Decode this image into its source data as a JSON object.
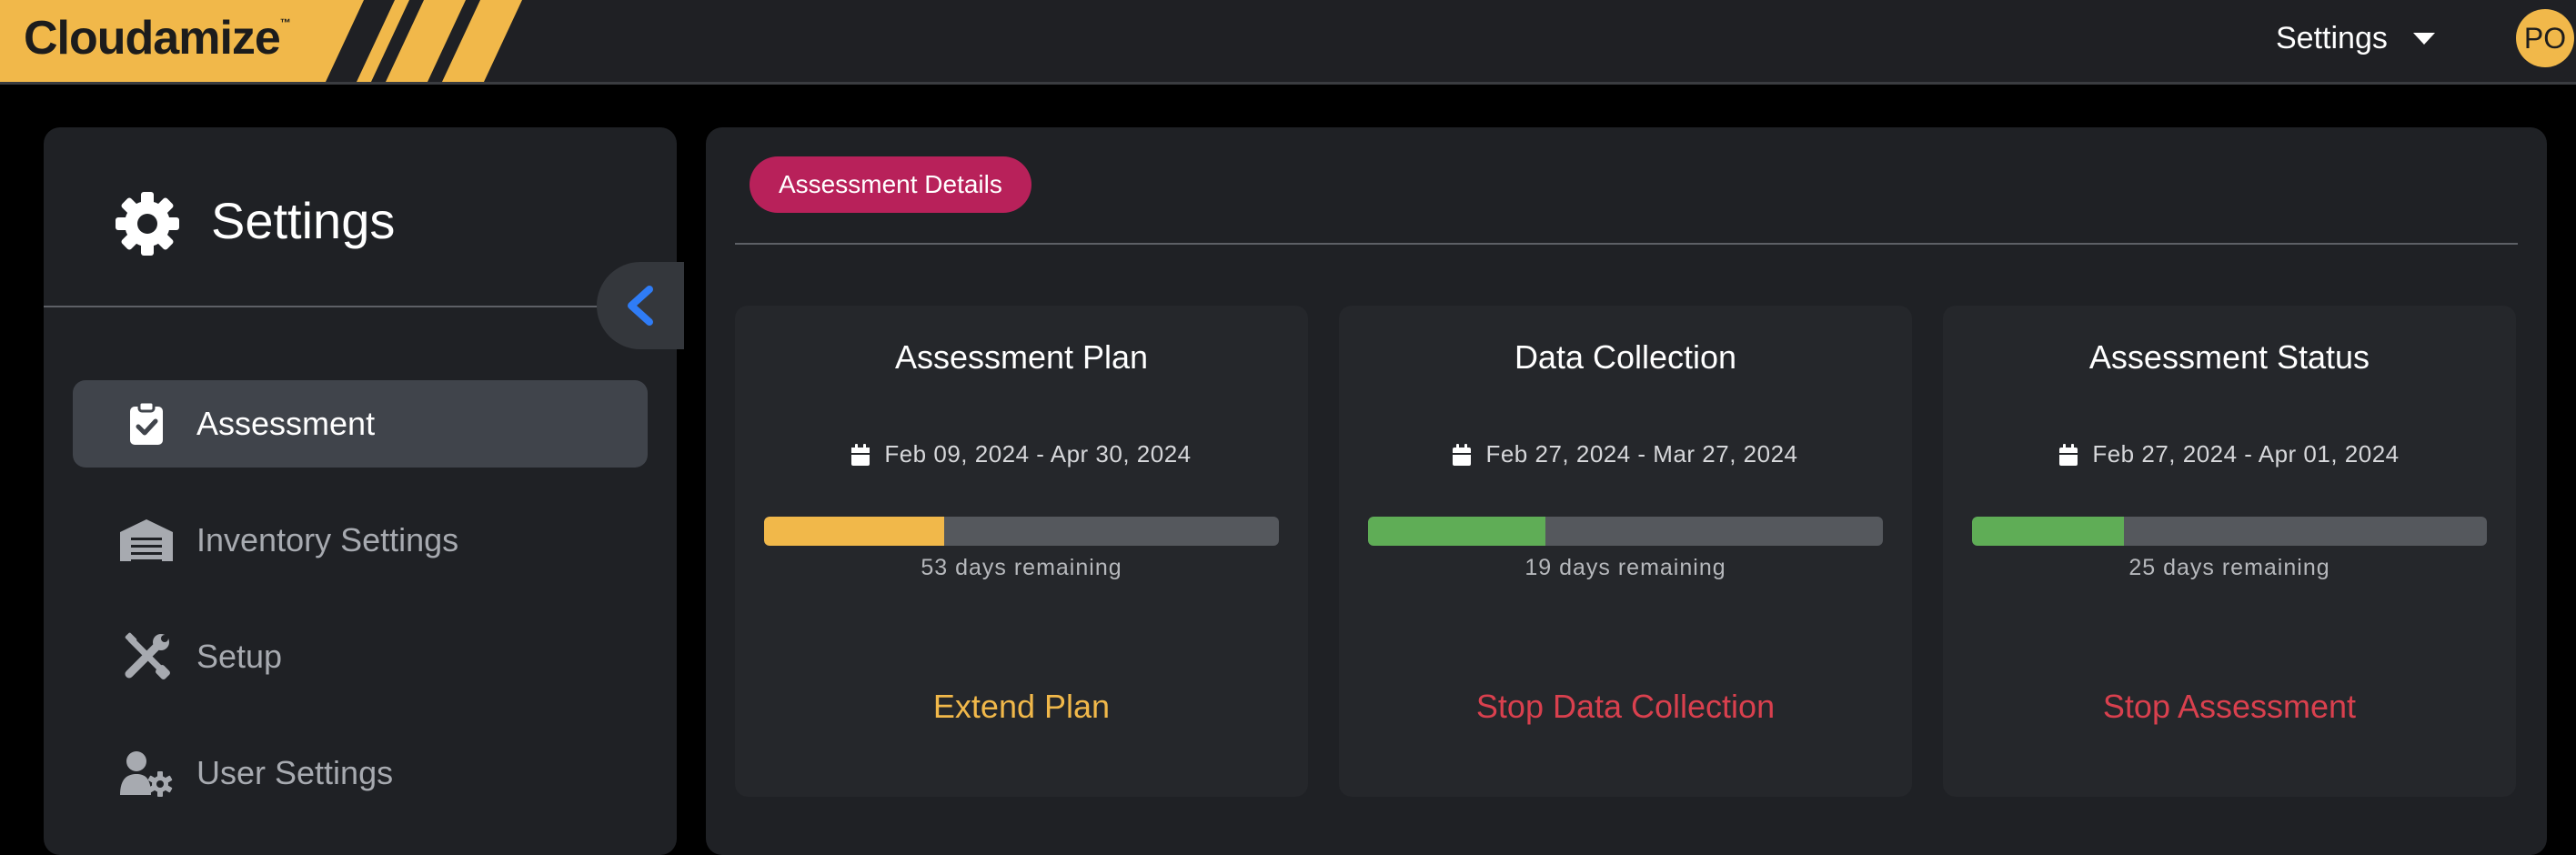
{
  "header": {
    "logo_text": "Cloudamize",
    "logo_tm": "™",
    "settings_label": "Settings",
    "avatar_initials": "PO",
    "brand_color": "#f1b84a"
  },
  "sidebar": {
    "title": "Settings",
    "items": [
      {
        "label": "Assessment",
        "icon": "clipboard-check-icon",
        "active": true
      },
      {
        "label": "Inventory Settings",
        "icon": "warehouse-icon",
        "active": false
      },
      {
        "label": "Setup",
        "icon": "tools-icon",
        "active": false
      },
      {
        "label": "User Settings",
        "icon": "user-gear-icon",
        "active": false
      }
    ]
  },
  "main": {
    "tab_label": "Assessment Details",
    "cards": [
      {
        "title": "Assessment Plan",
        "date_range": "Feb 09, 2024 - Apr 30, 2024",
        "progress": 0.35,
        "bar_color": "#f1b84a",
        "remaining": "53 days remaining",
        "action": "Extend Plan",
        "action_color": "#f1b84a"
      },
      {
        "title": "Data Collection",
        "date_range": "Feb 27, 2024 - Mar 27, 2024",
        "progress": 0.345,
        "bar_color": "#5fad56",
        "remaining": "19 days remaining",
        "action": "Stop Data Collection",
        "action_color": "#d9404e"
      },
      {
        "title": "Assessment Status",
        "date_range": "Feb 27, 2024 - Apr 01, 2024",
        "progress": 0.295,
        "bar_color": "#5fad56",
        "remaining": "25 days remaining",
        "action": "Stop Assessment",
        "action_color": "#d9404e"
      }
    ]
  }
}
